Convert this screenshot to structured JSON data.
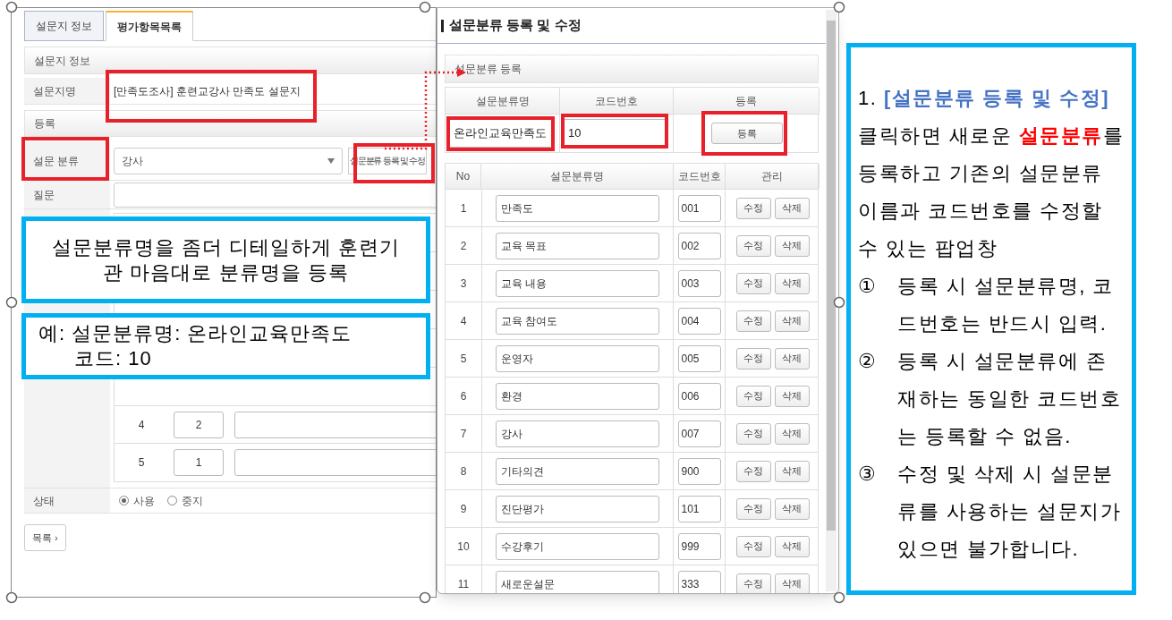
{
  "left_form": {
    "tabs": [
      {
        "label": "설문지 정보",
        "selected": false
      },
      {
        "label": "평가항목목록",
        "selected": true
      }
    ],
    "section_title": "설문지 정보",
    "survey_name": {
      "label": "설문지명",
      "value": "[만족도조사] 훈련교강사 만족도 설문지"
    },
    "register_title": "등록",
    "category": {
      "label": "설문 분류",
      "value": "강사",
      "button": "설문분류 등록 및 수정"
    },
    "question": {
      "label": "질문"
    },
    "answer_rows": [
      {
        "no": "4",
        "score": "2"
      },
      {
        "no": "5",
        "score": "1"
      }
    ],
    "status": {
      "label": "상태",
      "options": [
        {
          "label": "사용",
          "selected": true
        },
        {
          "label": "중지",
          "selected": false
        }
      ]
    },
    "list_button": "목록 ›"
  },
  "popup": {
    "title": "설문분류 등록 및 수정",
    "section_title": "설문분류 등록",
    "register_columns": [
      "설문분류명",
      "코드번호",
      "등록"
    ],
    "new_name": "온라인교육만족도",
    "new_code": "10",
    "register_button": "등록",
    "list_columns": [
      "No",
      "설문분류명",
      "코드번호",
      "관리"
    ],
    "rows": [
      {
        "no": "1",
        "name": "만족도",
        "code": "001",
        "edit": "수정",
        "delete": "삭제"
      },
      {
        "no": "2",
        "name": "교육 목표",
        "code": "002",
        "edit": "수정",
        "delete": "삭제"
      },
      {
        "no": "3",
        "name": "교육 내용",
        "code": "003",
        "edit": "수정",
        "delete": "삭제"
      },
      {
        "no": "4",
        "name": "교육 참여도",
        "code": "004",
        "edit": "수정",
        "delete": "삭제"
      },
      {
        "no": "5",
        "name": "운영자",
        "code": "005",
        "edit": "수정",
        "delete": "삭제"
      },
      {
        "no": "6",
        "name": "환경",
        "code": "006",
        "edit": "수정",
        "delete": "삭제"
      },
      {
        "no": "7",
        "name": "강사",
        "code": "007",
        "edit": "수정",
        "delete": "삭제"
      },
      {
        "no": "8",
        "name": "기타의견",
        "code": "900",
        "edit": "수정",
        "delete": "삭제"
      },
      {
        "no": "9",
        "name": "진단평가",
        "code": "101",
        "edit": "수정",
        "delete": "삭제"
      },
      {
        "no": "10",
        "name": "수강후기",
        "code": "999",
        "edit": "수정",
        "delete": "삭제"
      },
      {
        "no": "11",
        "name": "새로운설문",
        "code": "333",
        "edit": "수정",
        "delete": "삭제"
      }
    ]
  },
  "notes": [
    {
      "kind": "centered",
      "lines": [
        "설문분류명을 좀더 디테일하게 훈련기관 마음대로 분류명을 등록"
      ]
    },
    {
      "kind": "example",
      "lines": [
        "예: 설문분류명: 온라인교육만족도",
        "코드: 10"
      ]
    }
  ],
  "guide": {
    "number": "1.",
    "title": "[설문분류 등록 및 수정]",
    "intro": [
      {
        "kind": "plain",
        "text": "클릭하면 새로운 "
      },
      {
        "kind": "emphasis",
        "text": "설문분류"
      },
      {
        "kind": "plain",
        "text": "를 등록하고 기존의 설문분류 이름과 코드번호를 수정할 수 있는 팝업창"
      }
    ],
    "items": [
      {
        "marker": "①",
        "text": "등록 시 설문분류명, 코드번호는 반드시 입력."
      },
      {
        "marker": "②",
        "text": "등록 시 설문분류에 존재하는 동일한 코드번호는 등록할 수 없음."
      },
      {
        "marker": "③",
        "text": "수정 및 삭제 시 설문분류를 사용하는 설문지가 있으면 불가합니다."
      }
    ]
  }
}
